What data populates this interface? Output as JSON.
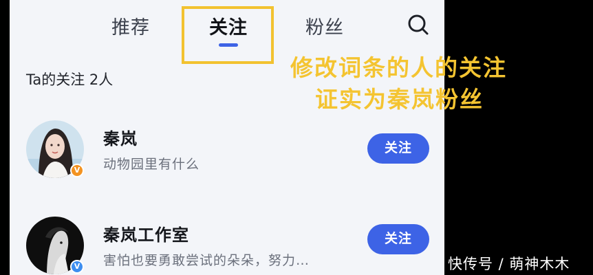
{
  "tabs": [
    {
      "label": "推荐",
      "active": false
    },
    {
      "label": "关注",
      "active": true
    },
    {
      "label": "粉丝",
      "active": false
    }
  ],
  "search_icon": "search-icon",
  "follow_count_text": "Ta的关注 2人",
  "accounts": [
    {
      "name": "秦岚",
      "description": "动物园里有什么",
      "verified_badge": "V",
      "badge_color": "#f39322",
      "button_label": "关注"
    },
    {
      "name": "秦岚工作室",
      "description": "害怕也要勇敢尝试的朵朵，努力…",
      "verified_badge": "V",
      "badge_color": "#3d8ef0",
      "button_label": "关注"
    }
  ],
  "annotation": {
    "line1": "修改词条的人的关注",
    "line2": "证实为秦岚粉丝",
    "color": "#f4c431"
  },
  "watermark": "快传号 / 萌神木木",
  "colors": {
    "accent": "#3d63e6",
    "highlight": "#f2c230",
    "background": "#f3f5f9"
  }
}
